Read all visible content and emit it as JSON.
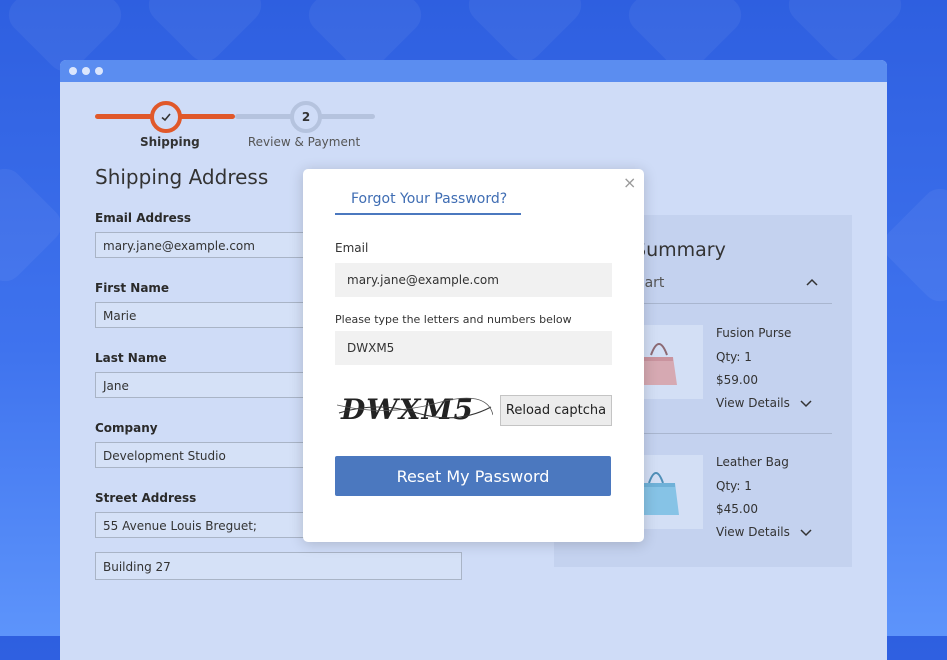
{
  "stepper": {
    "steps": [
      {
        "label": "Shipping"
      },
      {
        "number": "2",
        "label": "Review & Payment"
      }
    ]
  },
  "form": {
    "title": "Shipping Address",
    "fields": [
      {
        "label": "Email Address",
        "value": "mary.jane@example.com"
      },
      {
        "label": "First Name",
        "value": "Marie"
      },
      {
        "label": "Last Name",
        "value": "Jane"
      },
      {
        "label": "Company",
        "value": "Development Studio"
      },
      {
        "label": "Street Address",
        "value": "55 Avenue Louis Breguet;",
        "value2": "Building 27"
      }
    ]
  },
  "summary": {
    "title": "Order Summary",
    "items_label": "Items in Cart",
    "items": [
      {
        "name": "Fusion Purse",
        "qty": "Qty: 1",
        "price": "$59.00",
        "details": "View Details"
      },
      {
        "name": "Leather Bag",
        "qty": "Qty: 1",
        "price": "$45.00",
        "details": "View Details"
      }
    ]
  },
  "modal": {
    "title": "Forgot Your Password?",
    "email_label": "Email",
    "email_value": "mary.jane@example.com",
    "captcha_label": "Please type the letters and numbers below",
    "captcha_value": "DWXM5",
    "captcha_image_text": "DWXM5",
    "reload_label": "Reload captcha",
    "submit_label": "Reset My Password",
    "close_symbol": "×"
  },
  "colors": {
    "accent_orange": "#e0582a",
    "primary_blue": "#4b78bf",
    "window_bg": "#cfdcf7"
  },
  "icons": [
    "checkmark-icon",
    "chevron-up-icon",
    "chevron-down-icon",
    "close-icon"
  ]
}
